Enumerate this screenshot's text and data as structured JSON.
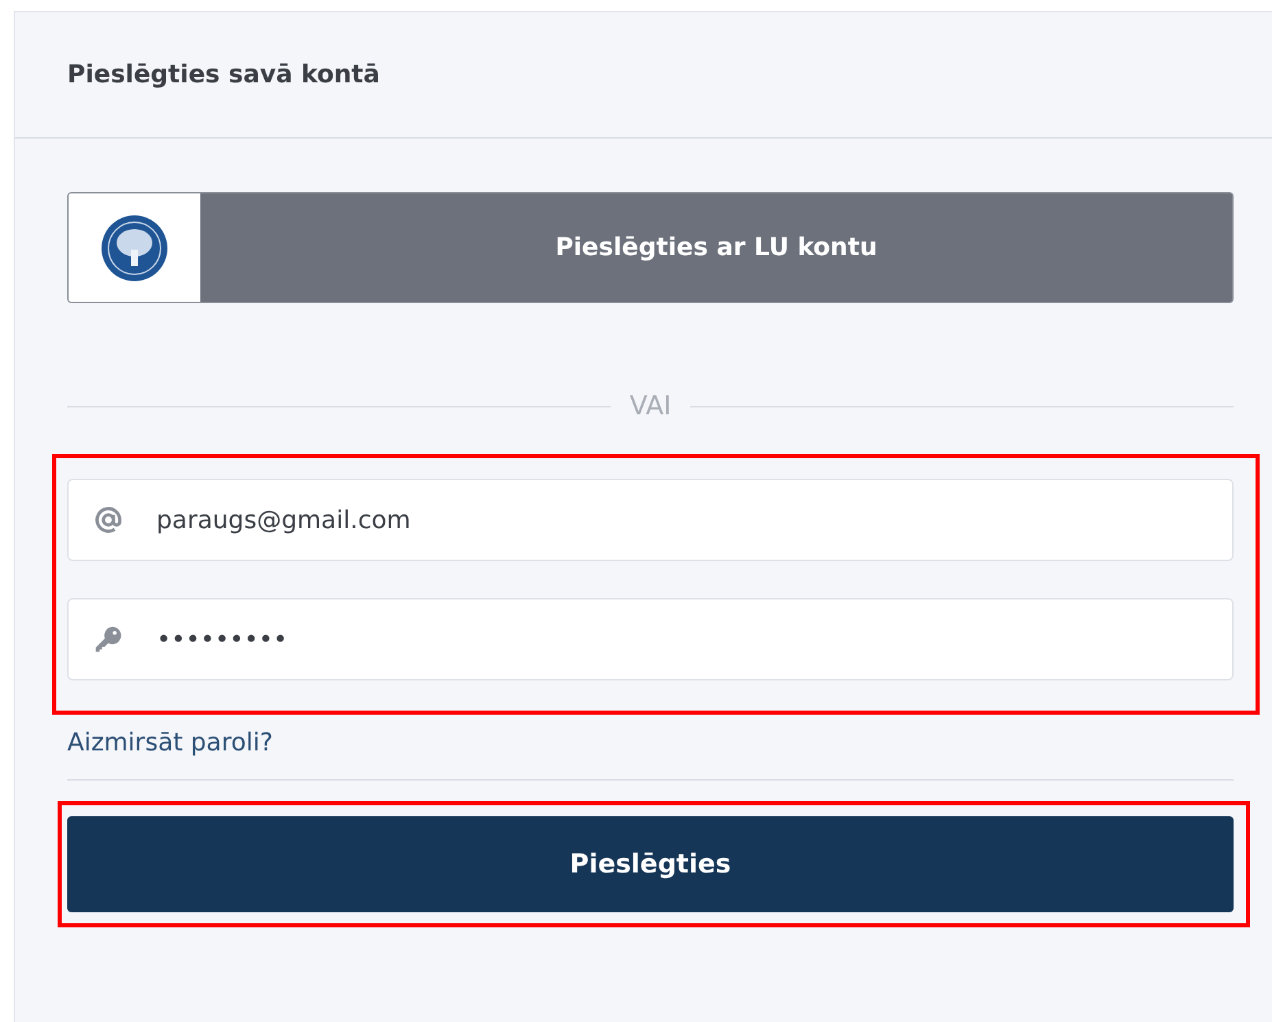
{
  "card": {
    "title": "Pieslēgties savā kontā"
  },
  "sso_button": {
    "label": "Pieslēgties ar LU kontu"
  },
  "divider": {
    "label": "VAI"
  },
  "fields": [
    {
      "kind": "email",
      "value": "paraugs@gmail.com"
    },
    {
      "kind": "password",
      "value": "•••••••••"
    }
  ],
  "forgot_link": "Aizmirsāt paroli?",
  "submit_button": {
    "label": "Pieslēgties"
  }
}
